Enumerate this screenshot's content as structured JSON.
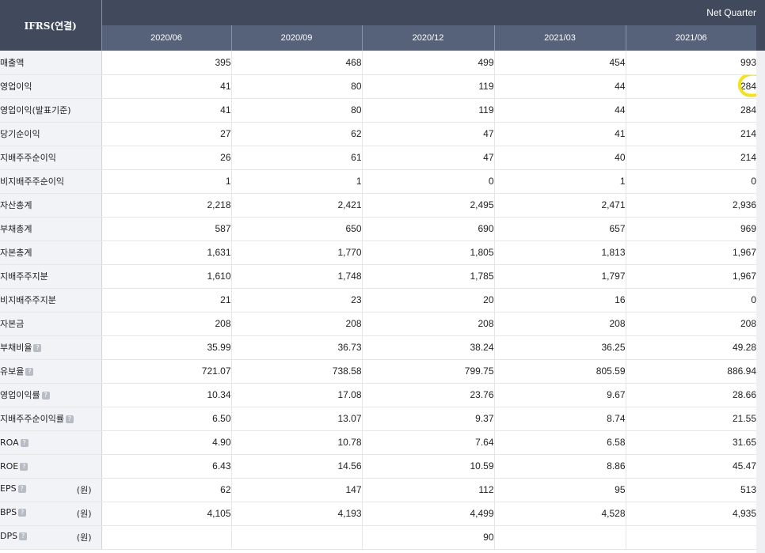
{
  "table": {
    "corner_label": "IFRS(연결)",
    "group_label": "Net Quarter",
    "periods": [
      "2020/06",
      "2020/09",
      "2020/12",
      "2021/03",
      "2021/06"
    ],
    "rows": [
      {
        "label": "매출액",
        "values": [
          "395",
          "468",
          "499",
          "454",
          "993"
        ]
      },
      {
        "label": "영업이익",
        "values": [
          "41",
          "80",
          "119",
          "44",
          "284"
        ]
      },
      {
        "label": "영업이익(발표기준)",
        "values": [
          "41",
          "80",
          "119",
          "44",
          "284"
        ]
      },
      {
        "label": "당기순이익",
        "values": [
          "27",
          "62",
          "47",
          "41",
          "214"
        ]
      },
      {
        "label": "지배주주순이익",
        "values": [
          "26",
          "61",
          "47",
          "40",
          "214"
        ]
      },
      {
        "label": "비지배주주순이익",
        "values": [
          "1",
          "1",
          "0",
          "1",
          "0"
        ]
      },
      {
        "label": "자산총계",
        "values": [
          "2,218",
          "2,421",
          "2,495",
          "2,471",
          "2,936"
        ]
      },
      {
        "label": "부채총계",
        "values": [
          "587",
          "650",
          "690",
          "657",
          "969"
        ]
      },
      {
        "label": "자본총계",
        "values": [
          "1,631",
          "1,770",
          "1,805",
          "1,813",
          "1,967"
        ]
      },
      {
        "label": "지배주주지분",
        "values": [
          "1,610",
          "1,748",
          "1,785",
          "1,797",
          "1,967"
        ]
      },
      {
        "label": "비지배주주지분",
        "values": [
          "21",
          "23",
          "20",
          "16",
          "0"
        ]
      },
      {
        "label": "자본금",
        "values": [
          "208",
          "208",
          "208",
          "208",
          "208"
        ]
      },
      {
        "label": "부채비율",
        "values": [
          "35.99",
          "36.73",
          "38.24",
          "36.25",
          "49.28"
        ]
      },
      {
        "label": "유보율",
        "values": [
          "721.07",
          "738.58",
          "799.75",
          "805.59",
          "886.94"
        ]
      },
      {
        "label": "영업이익률",
        "values": [
          "10.34",
          "17.08",
          "23.76",
          "9.67",
          "28.66"
        ]
      },
      {
        "label": "지배주주순이익률",
        "values": [
          "6.50",
          "13.07",
          "9.37",
          "8.74",
          "21.55"
        ]
      },
      {
        "label": "ROA",
        "values": [
          "4.90",
          "10.78",
          "7.64",
          "6.58",
          "31.65"
        ]
      },
      {
        "label": "ROE",
        "values": [
          "6.43",
          "14.56",
          "10.59",
          "8.86",
          "45.47"
        ]
      },
      {
        "label": "EPS",
        "unit": "(원)",
        "values": [
          "62",
          "147",
          "112",
          "95",
          "513"
        ]
      },
      {
        "label": "BPS",
        "unit": "(원)",
        "values": [
          "4,105",
          "4,193",
          "4,499",
          "4,528",
          "4,935"
        ]
      },
      {
        "label": "DPS",
        "unit": "(원)",
        "values": [
          "",
          "",
          "90",
          "",
          ""
        ]
      }
    ]
  },
  "help_icon": {
    "glyph": "?"
  },
  "highlight": {
    "color": "#f5e21a",
    "row": "영업이익",
    "period": "2021/06"
  },
  "colors": {
    "header_dark": "#404a5c",
    "header_sub": "#56627a",
    "label_bg": "#f2f3f7"
  }
}
